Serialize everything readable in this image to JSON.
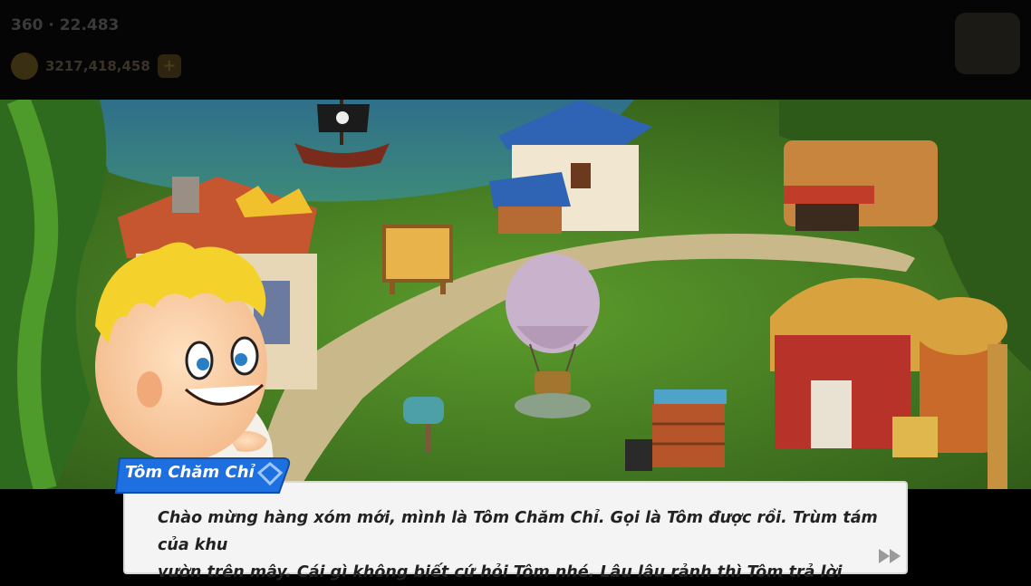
{
  "hud": {
    "stats_text": "360 · 22.483",
    "coins": "3217,418,458",
    "plus": "+"
  },
  "dialog": {
    "speaker": "Tôm Chăm Chỉ",
    "line1": "Chào mừng hàng xóm mới, mình là Tôm Chăm Chỉ. Gọi là Tôm được rồi. Trùm tám của khu",
    "line2": "vườn trên mây. Cái gì không biết cứ hỏi Tôm nhé. Lâu lâu rảnh thì Tôm trả lời"
  },
  "icons": {
    "next": "fast-forward-icon",
    "settings": "gear-icon",
    "coin": "coin-icon"
  },
  "colors": {
    "nameplate": "#1e6fe0",
    "dialog_bg": "#f4f4f4",
    "grass": "#5a9a2a"
  }
}
